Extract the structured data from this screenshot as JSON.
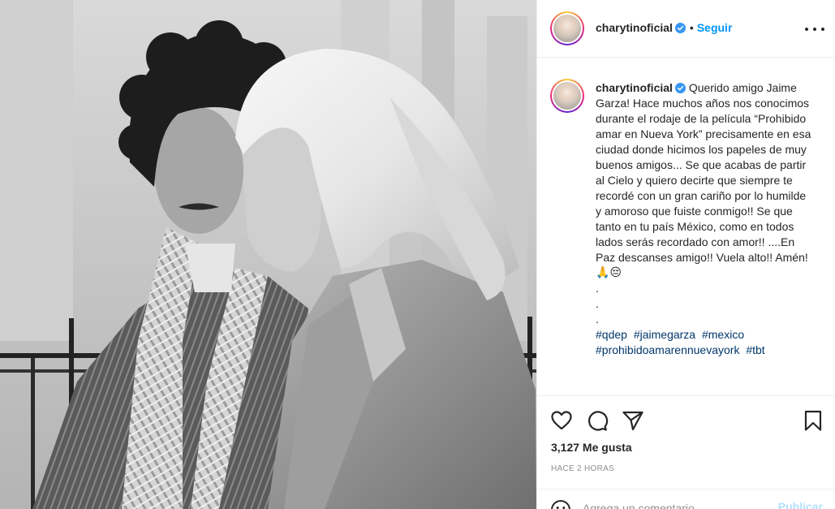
{
  "post": {
    "username": "charytinoficial",
    "follow_label": "Seguir",
    "separator": "•"
  },
  "caption": {
    "username": "charytinoficial",
    "text": "Querido amigo Jaime Garza! Hace muchos años nos conocimos durante el rodaje de la película “Prohibido amar en Nueva York” precisamente en esa ciudad donde hicimos los papeles de muy buenos amigos... Se que acabas de partir al Cielo y quiero decirte que siempre te recordé con un gran cariño por lo humilde y amoroso que fuiste conmigo!! Se que tanto en tu país México, como en todos lados serás recordado con amor!! ....En Paz descanses amigo!! Vuela alto!! Amén!",
    "emojis": "🙏😔",
    "dots": [
      ".",
      ".",
      "."
    ],
    "hashtags": [
      "#qdep",
      "#jaimegarza",
      "#mexico",
      "#prohibidoamarennuevayork",
      "#tbt"
    ]
  },
  "engagement": {
    "likes": "3,127 Me gusta",
    "timestamp": "HACE 2 HORAS"
  },
  "comment_box": {
    "placeholder": "Agrega un comentario...",
    "publish_label": "Publicar"
  },
  "icons": {
    "verified": "verified-badge-icon",
    "more": "more-options-icon",
    "like": "heart-icon",
    "comment": "comment-bubble-icon",
    "share": "paper-plane-icon",
    "save": "bookmark-icon",
    "emoji": "smiley-icon"
  },
  "colors": {
    "accent": "#0095f6",
    "hashtag": "#00376b",
    "publish_disabled": "#b2dffc",
    "muted": "#8e8e8e"
  }
}
